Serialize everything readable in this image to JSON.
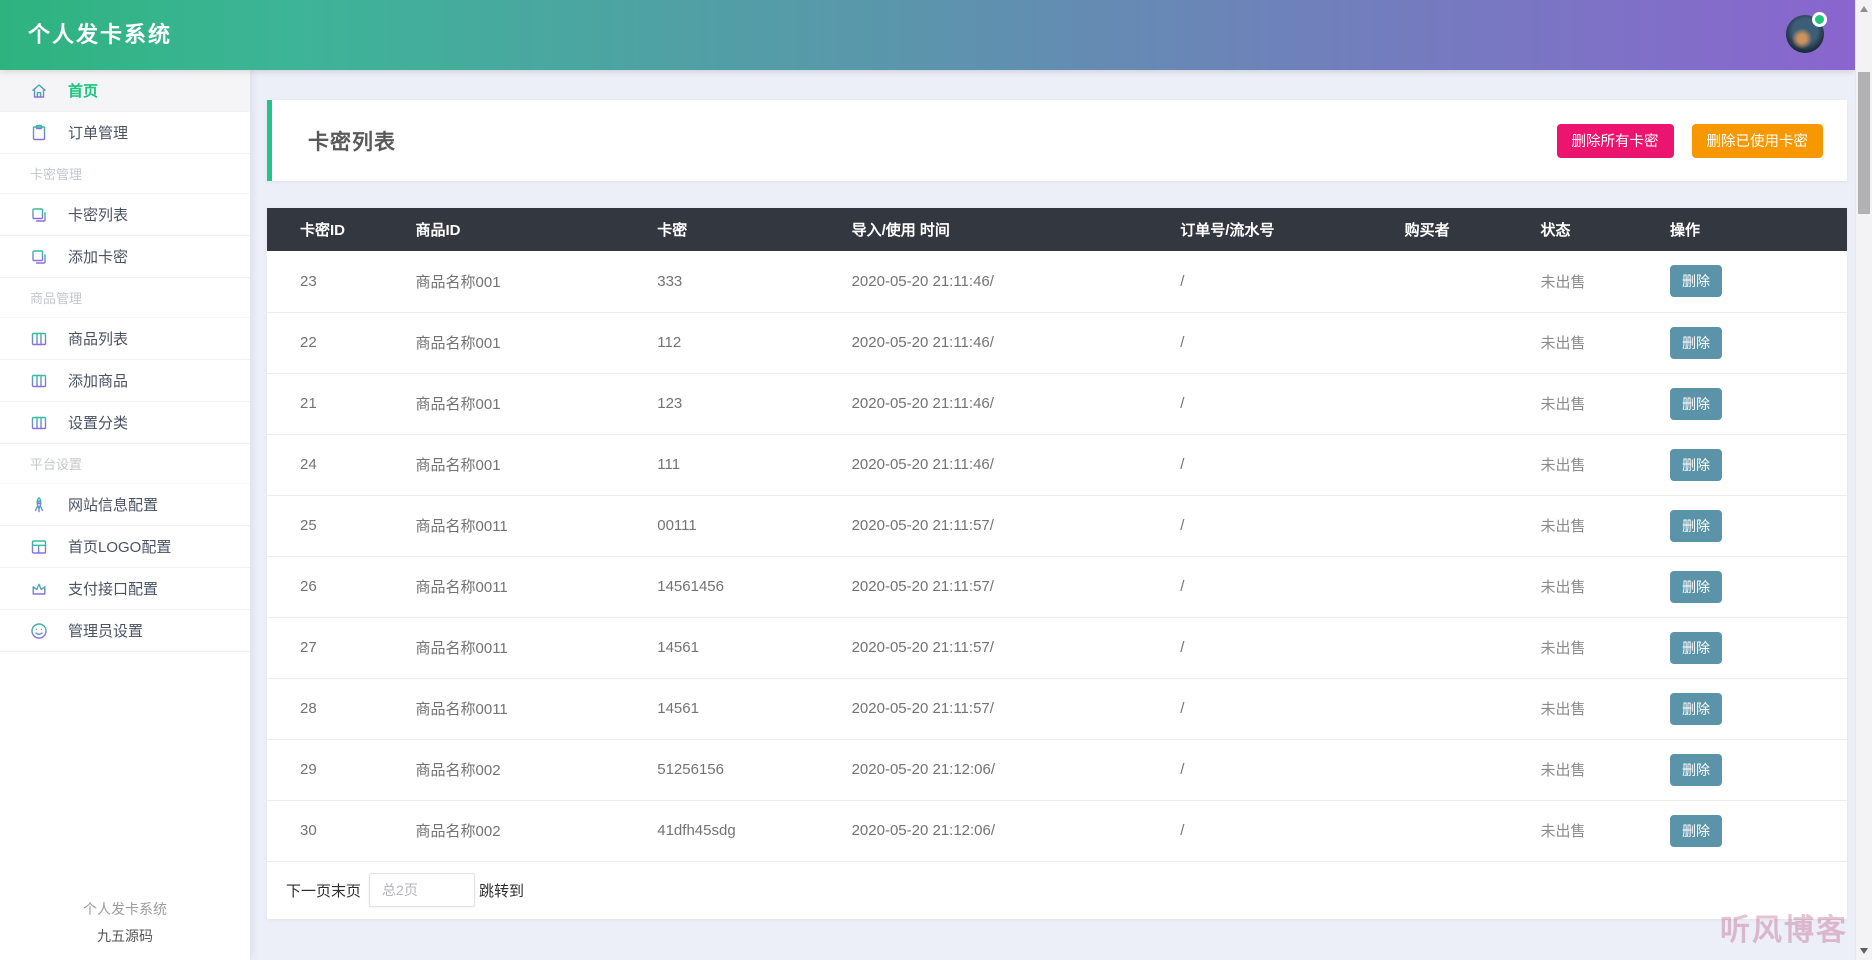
{
  "header": {
    "title": "个人发卡系统"
  },
  "sidebar": {
    "items": [
      {
        "type": "item",
        "icon": "home-icon",
        "label": "首页",
        "active": true
      },
      {
        "type": "item",
        "icon": "clipboard-icon",
        "label": "订单管理"
      },
      {
        "type": "section",
        "label": "卡密管理"
      },
      {
        "type": "item",
        "icon": "copy-icon",
        "label": "卡密列表"
      },
      {
        "type": "item",
        "icon": "copy-icon",
        "label": "添加卡密"
      },
      {
        "type": "section",
        "label": "商品管理"
      },
      {
        "type": "item",
        "icon": "book-icon",
        "label": "商品列表"
      },
      {
        "type": "item",
        "icon": "book-icon",
        "label": "添加商品"
      },
      {
        "type": "item",
        "icon": "book-icon",
        "label": "设置分类"
      },
      {
        "type": "section",
        "label": "平台设置"
      },
      {
        "type": "item",
        "icon": "rocket-icon",
        "label": "网站信息配置"
      },
      {
        "type": "item",
        "icon": "layout-icon",
        "label": "首页LOGO配置"
      },
      {
        "type": "item",
        "icon": "crown-icon",
        "label": "支付接口配置"
      },
      {
        "type": "item",
        "icon": "smiley-icon",
        "label": "管理员设置"
      }
    ],
    "footer": {
      "line1": "个人发卡系统",
      "line2": "九五源码"
    }
  },
  "main": {
    "page_title": "卡密列表",
    "buttons": {
      "delete_all": "删除所有卡密",
      "delete_used": "删除已使用卡密"
    }
  },
  "table": {
    "headers": [
      "卡密ID",
      "商品ID",
      "卡密",
      "导入/使用 时间",
      "订单号/流水号",
      "购买者",
      "状态",
      "操作"
    ],
    "row_action_label": "删除",
    "rows": [
      {
        "card_id": "23",
        "product_id": "商品名称001",
        "secret": "333",
        "time": "2020-05-20 21:11:46/",
        "order_no": "/",
        "buyer": "",
        "status": "未出售"
      },
      {
        "card_id": "22",
        "product_id": "商品名称001",
        "secret": "112",
        "time": "2020-05-20 21:11:46/",
        "order_no": "/",
        "buyer": "",
        "status": "未出售"
      },
      {
        "card_id": "21",
        "product_id": "商品名称001",
        "secret": "123",
        "time": "2020-05-20 21:11:46/",
        "order_no": "/",
        "buyer": "",
        "status": "未出售"
      },
      {
        "card_id": "24",
        "product_id": "商品名称001",
        "secret": "111",
        "time": "2020-05-20 21:11:46/",
        "order_no": "/",
        "buyer": "",
        "status": "未出售"
      },
      {
        "card_id": "25",
        "product_id": "商品名称0011",
        "secret": "00111",
        "time": "2020-05-20 21:11:57/",
        "order_no": "/",
        "buyer": "",
        "status": "未出售"
      },
      {
        "card_id": "26",
        "product_id": "商品名称0011",
        "secret": "14561456",
        "time": "2020-05-20 21:11:57/",
        "order_no": "/",
        "buyer": "",
        "status": "未出售"
      },
      {
        "card_id": "27",
        "product_id": "商品名称0011",
        "secret": "14561",
        "time": "2020-05-20 21:11:57/",
        "order_no": "/",
        "buyer": "",
        "status": "未出售"
      },
      {
        "card_id": "28",
        "product_id": "商品名称0011",
        "secret": "14561",
        "time": "2020-05-20 21:11:57/",
        "order_no": "/",
        "buyer": "",
        "status": "未出售"
      },
      {
        "card_id": "29",
        "product_id": "商品名称002",
        "secret": "51256156",
        "time": "2020-05-20 21:12:06/",
        "order_no": "/",
        "buyer": "",
        "status": "未出售"
      },
      {
        "card_id": "30",
        "product_id": "商品名称002",
        "secret": "41dfh45sdg",
        "time": "2020-05-20 21:12:06/",
        "order_no": "/",
        "buyer": "",
        "status": "未出售"
      }
    ]
  },
  "pagination": {
    "next_label": "下一页",
    "last_label": "末页",
    "page_input_placeholder": "总2页",
    "jump_label": "跳转到"
  },
  "watermark": "听风博客",
  "colors": {
    "header_gradient_start": "#2eb37f",
    "header_gradient_end": "#8a65cf",
    "accent_green": "#19c57f",
    "btn_delete_all": "#ed146f",
    "btn_delete_used": "#f79800",
    "btn_row_delete": "#5b93a8",
    "table_header_bg": "#333840",
    "status_dot": "#1fc77c"
  }
}
